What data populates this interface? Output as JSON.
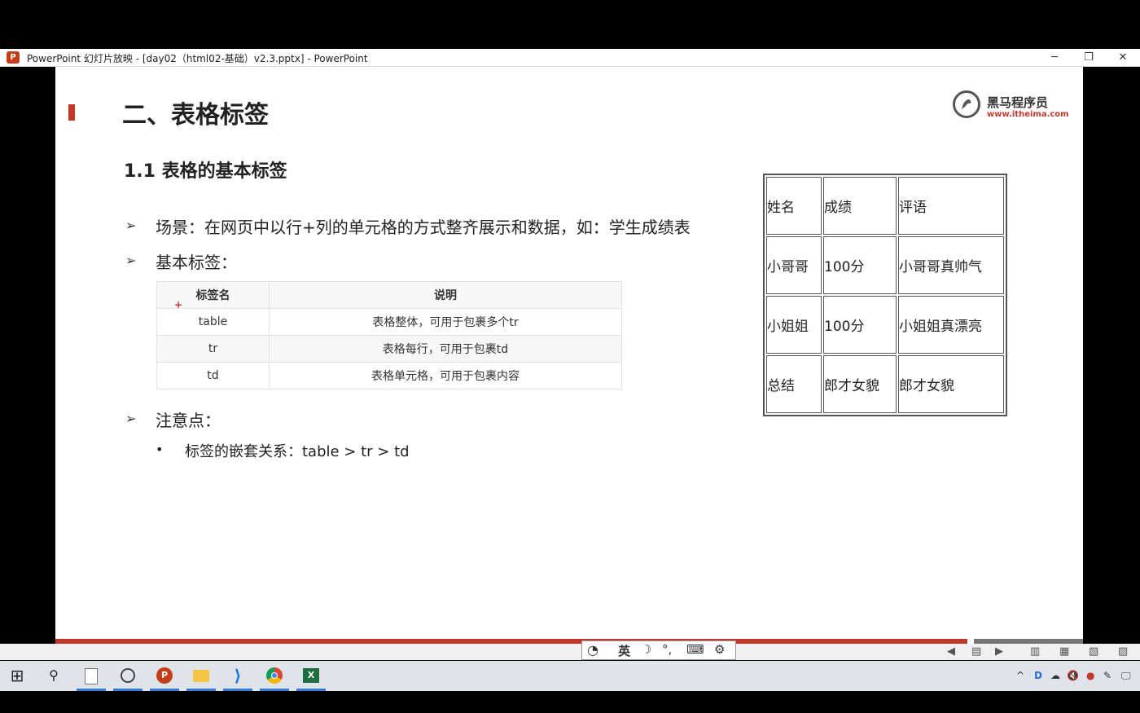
{
  "window": {
    "app_icon_text": "P",
    "title": "PowerPoint 幻灯片放映 - [day02（html02-基础）v2.3.pptx] - PowerPoint",
    "minimize": "─",
    "restore": "❐",
    "close": "✕"
  },
  "slide": {
    "title": "二、表格标签",
    "logo_name": "黑马程序员",
    "logo_url": "www.itheima.com",
    "subtitle": "1.1 表格的基本标签",
    "bullet_symbol": "➢",
    "bullets": [
      "场景：在网页中以行+列的单元格的方式整齐展示和数据，如：学生成绩表",
      "基本标签：",
      "注意点："
    ],
    "sub_bullet_symbol": "•",
    "sub_bullet": "标签的嵌套关系：table >  tr > td",
    "table": {
      "headers": [
        "标签名",
        "说明"
      ],
      "rows": [
        [
          "table",
          "表格整体，可用于包裹多个tr"
        ],
        [
          "tr",
          "表格每行，可用于包裹td"
        ],
        [
          "td",
          "表格单元格，可用于包裹内容"
        ]
      ]
    },
    "plus_mark": "+",
    "demo_table": [
      [
        "姓名",
        "成绩",
        "评语"
      ],
      [
        "小哥哥",
        "100分",
        "小哥哥真帅气"
      ],
      [
        "小姐姐",
        "100分",
        "小姐姐真漂亮"
      ],
      [
        "总结",
        "郎才女貌",
        "郎才女貌"
      ]
    ]
  },
  "ime": {
    "mode": "英",
    "moon": "☽",
    "punct": "°,",
    "keyboard": "⌨",
    "settings": "⚙"
  },
  "slideshow_nav": [
    "◀",
    "▤",
    "▶",
    "▥",
    "▦",
    "▧",
    "▨"
  ],
  "taskbar": {
    "start": "⊞",
    "search": "⚲",
    "apps": [
      "file",
      "browser-alt",
      "powerpoint",
      "files",
      "vscode",
      "chrome",
      "excel"
    ],
    "tray": [
      "^",
      "D",
      "☁",
      "🔇",
      "●",
      "✎",
      "🖵"
    ]
  },
  "colors": {
    "accent_red": "#c0392b",
    "taskbar": "#dfe4ea",
    "powerpoint": "#c43e1c"
  }
}
